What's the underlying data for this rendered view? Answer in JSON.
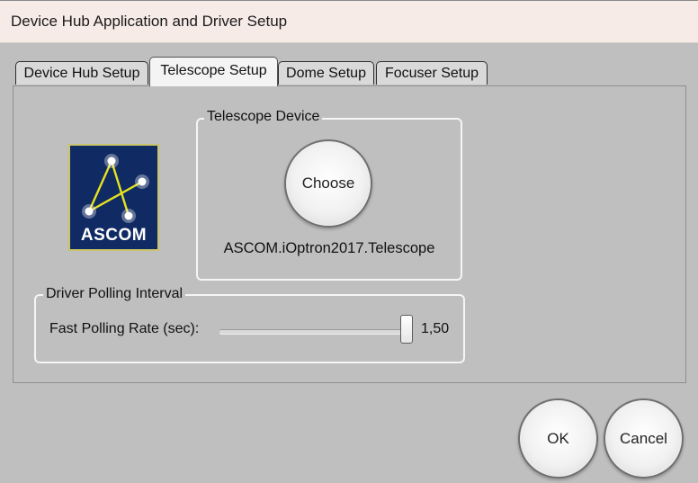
{
  "window": {
    "title": "Device Hub Application and Driver Setup"
  },
  "tabs": [
    {
      "label": "Device Hub Setup",
      "active": false
    },
    {
      "label": "Telescope Setup",
      "active": true
    },
    {
      "label": "Dome Setup",
      "active": false
    },
    {
      "label": "Focuser Setup",
      "active": false
    }
  ],
  "logo": {
    "text": "ASCOM",
    "icon": "ascom-logo-icon",
    "background": "#102a63",
    "accent": "#c9c36a"
  },
  "telescope_device": {
    "legend": "Telescope Device",
    "choose_label": "Choose",
    "device_name": "ASCOM.iOptron2017.Telescope"
  },
  "polling": {
    "legend": "Driver Polling Interval",
    "fast_rate_label": "Fast Polling Rate (sec):",
    "fast_rate_value": "1,50",
    "slider_position": 1.0
  },
  "buttons": {
    "ok_label": "OK",
    "cancel_label": "Cancel"
  }
}
